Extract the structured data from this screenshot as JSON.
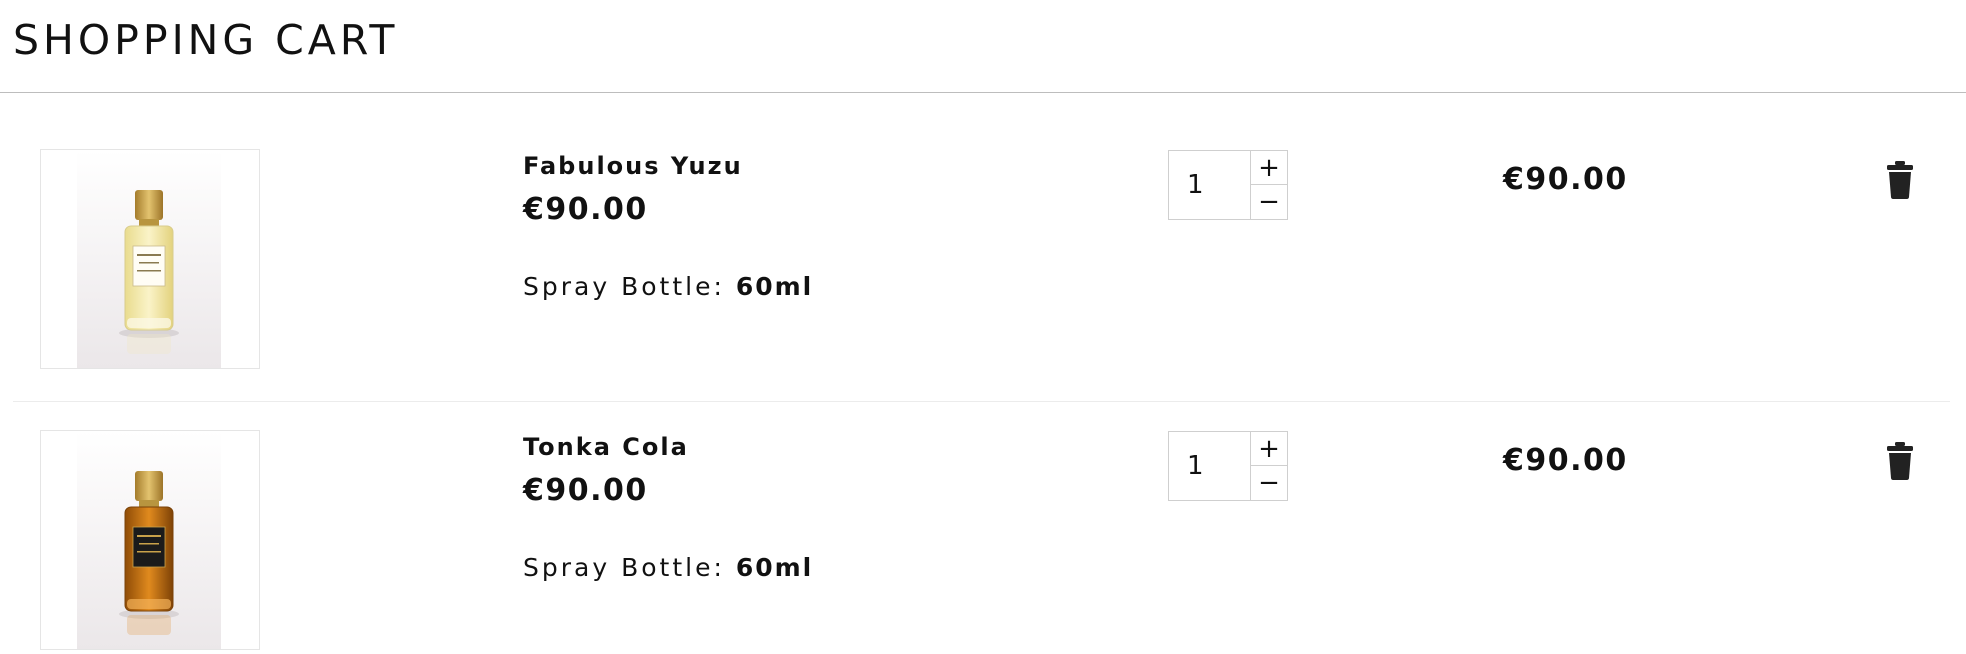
{
  "page": {
    "title": "SHOPPING CART"
  },
  "colors": {
    "text": "#111111",
    "divider": "#bdbdbd",
    "yuzu_liquid": "#f2e6a6",
    "cola_liquid": "#b86a10",
    "cap_gold": "#c9a24a"
  },
  "cart": {
    "items": [
      {
        "name": "Fabulous Yuzu",
        "unit_price": "€90.00",
        "variant_label": "Spray Bottle:",
        "variant_value": "60ml",
        "quantity": "1",
        "plus_label": "+",
        "minus_label": "−",
        "line_total": "€90.00",
        "delete_icon": "trash-icon"
      },
      {
        "name": "Tonka Cola",
        "unit_price": "€90.00",
        "variant_label": "Spray Bottle:",
        "variant_value": "60ml",
        "quantity": "1",
        "plus_label": "+",
        "minus_label": "−",
        "line_total": "€90.00",
        "delete_icon": "trash-icon"
      }
    ]
  }
}
